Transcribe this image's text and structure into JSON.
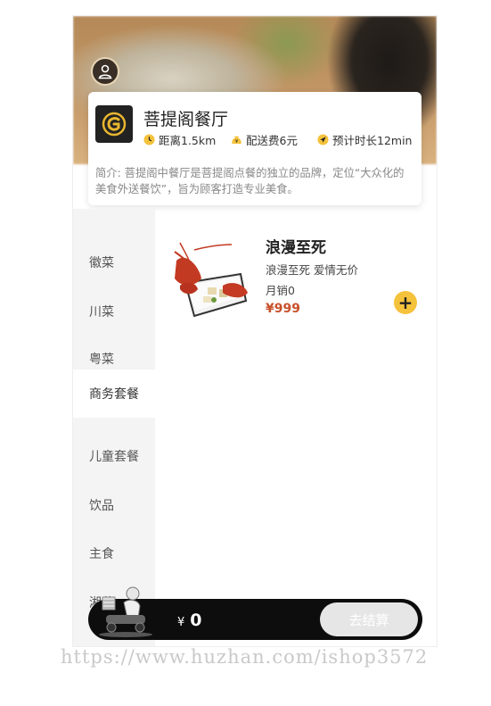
{
  "shop": {
    "name": "菩提阁餐厅",
    "distance": "距离1.5km",
    "delivery_fee": "配送费6元",
    "eta": "预计时长12min",
    "intro": "简介: 菩提阁中餐厅是菩提阁点餐的独立的品牌，定位“大众化的美食外送餐饮”，旨为顾客打造专业美食。"
  },
  "categories": [
    "徽菜",
    "川菜",
    "粤菜",
    "商务套餐",
    "儿童套餐",
    "饮品",
    "主食",
    "湘菜"
  ],
  "active_category_index": 3,
  "dish": {
    "title": "浪漫至死",
    "subtitle": "浪漫至死 爱情无价",
    "sales": "月销0",
    "price": "¥999",
    "add_label": "+"
  },
  "cart": {
    "currency": "¥",
    "total": "0",
    "checkout_label": "去结算"
  },
  "watermark": "https://www.huzhan.com/ishop3572",
  "colors": {
    "accent": "#f5c23b",
    "price": "#c8502a",
    "cart_bar": "#0d0d0d"
  },
  "icons": [
    "user-icon",
    "clock-icon",
    "money-bag-icon",
    "location-arrow-icon",
    "cart-mascot-icon"
  ]
}
